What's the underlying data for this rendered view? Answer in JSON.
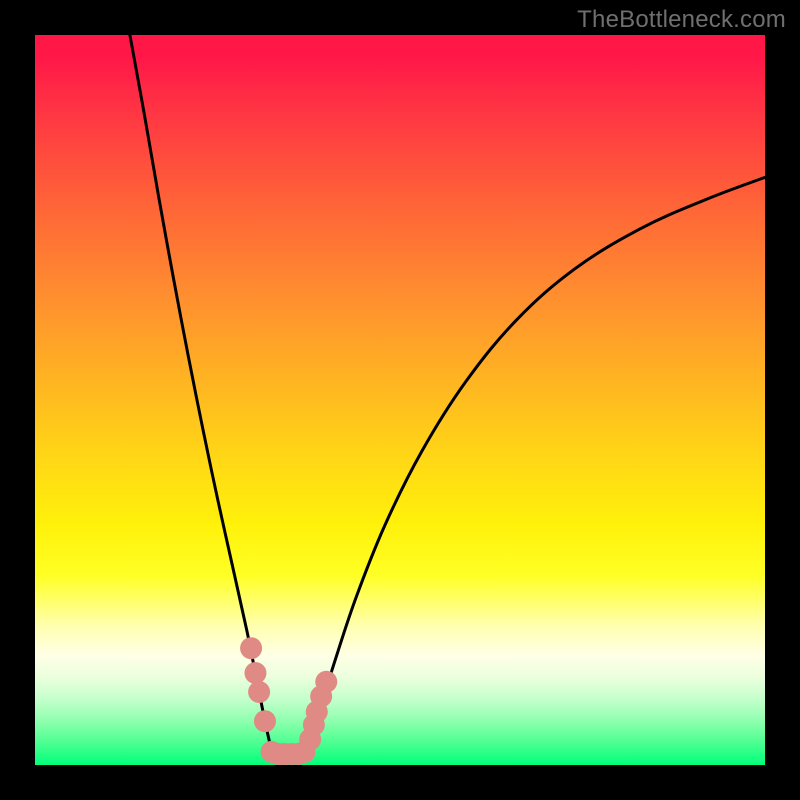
{
  "watermark": "TheBottleneck.com",
  "colors": {
    "frame": "#000000",
    "curve": "#000000",
    "markers": "#e08a86",
    "gradient_stops": [
      "#ff1748",
      "#ff3b42",
      "#ff6a36",
      "#ff8f2f",
      "#ffb322",
      "#ffd716",
      "#fff10a",
      "#ffff25",
      "#ffffb0",
      "#ffffe6",
      "#eaffdd",
      "#c4ffcc",
      "#8dffae",
      "#4bff91",
      "#00ff7a"
    ]
  },
  "chart_data": {
    "type": "line",
    "title": "",
    "xlabel": "",
    "ylabel": "",
    "xlim": [
      0,
      100
    ],
    "ylim": [
      0,
      100
    ],
    "series": [
      {
        "name": "bottleneck-curve-left",
        "x": [
          13.0,
          15.0,
          17.0,
          19.0,
          21.0,
          23.0,
          25.0,
          27.0,
          29.0,
          30.3,
          31.5,
          32.5
        ],
        "values": [
          100.0,
          89.0,
          77.5,
          66.5,
          56.0,
          46.0,
          36.5,
          27.5,
          18.5,
          12.0,
          6.0,
          1.5
        ]
      },
      {
        "name": "bottleneck-curve-right",
        "x": [
          37.0,
          38.5,
          41.0,
          44.0,
          48.0,
          53.0,
          59.0,
          66.0,
          74.0,
          83.0,
          92.0,
          100.0
        ],
        "values": [
          1.5,
          6.0,
          14.0,
          23.0,
          33.0,
          43.0,
          52.5,
          61.0,
          68.0,
          73.5,
          77.5,
          80.5
        ]
      }
    ],
    "markers": {
      "name": "highlight-points",
      "points": [
        {
          "x": 29.6,
          "y": 16.0
        },
        {
          "x": 30.2,
          "y": 12.6
        },
        {
          "x": 30.7,
          "y": 10.0
        },
        {
          "x": 31.5,
          "y": 6.0
        },
        {
          "x": 32.4,
          "y": 1.8
        },
        {
          "x": 33.4,
          "y": 1.5
        },
        {
          "x": 34.2,
          "y": 1.5
        },
        {
          "x": 35.1,
          "y": 1.5
        },
        {
          "x": 36.0,
          "y": 1.5
        },
        {
          "x": 36.9,
          "y": 1.8
        },
        {
          "x": 37.7,
          "y": 3.5
        },
        {
          "x": 38.2,
          "y": 5.5
        },
        {
          "x": 38.6,
          "y": 7.3
        },
        {
          "x": 39.2,
          "y": 9.4
        },
        {
          "x": 39.9,
          "y": 11.4
        }
      ]
    }
  }
}
